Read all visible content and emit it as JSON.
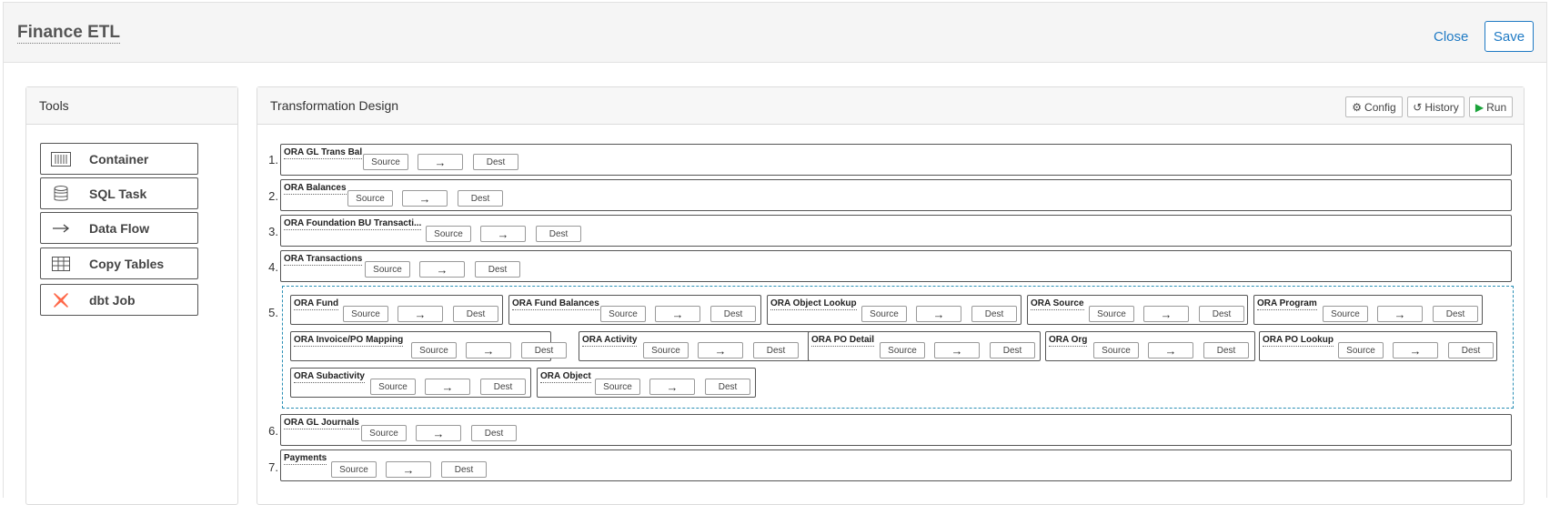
{
  "header": {
    "title": "Finance ETL",
    "close_label": "Close",
    "save_label": "Save"
  },
  "tools": {
    "title": "Tools",
    "items": [
      {
        "label": "Container",
        "icon": "container-icon"
      },
      {
        "label": "SQL Task",
        "icon": "database-icon"
      },
      {
        "label": "Data Flow",
        "icon": "arrow-right-icon"
      },
      {
        "label": "Copy Tables",
        "icon": "table-icon"
      },
      {
        "label": "dbt Job",
        "icon": "dbt-icon"
      }
    ]
  },
  "design": {
    "title": "Transformation Design",
    "config_label": "Config",
    "history_label": "History",
    "run_label": "Run",
    "source_label": "Source",
    "arrow_label": "→",
    "dest_label": "Dest",
    "steps": [
      {
        "num": "1.",
        "name": "ORA GL Trans Bal"
      },
      {
        "num": "2.",
        "name": "ORA Balances"
      },
      {
        "num": "3.",
        "name": "ORA Foundation BU Transacti..."
      },
      {
        "num": "4.",
        "name": "ORA Transactions"
      },
      {
        "num": "5.",
        "children": [
          "ORA Fund",
          "ORA Fund Balances",
          "ORA Object Lookup",
          "ORA Source",
          "ORA Program",
          "ORA Invoice/PO Mapping",
          "ORA Activity",
          "ORA PO Detail",
          "ORA Org",
          "ORA PO Lookup",
          "ORA Subactivity",
          "ORA Object"
        ]
      },
      {
        "num": "6.",
        "name": "ORA GL Journals"
      },
      {
        "num": "7.",
        "name": "Payments"
      }
    ]
  },
  "colors": {
    "accent": "#1f7ac4",
    "container_border": "#2a8fb5",
    "run_green": "#1aa33a",
    "dbt_orange": "#ff694a"
  }
}
